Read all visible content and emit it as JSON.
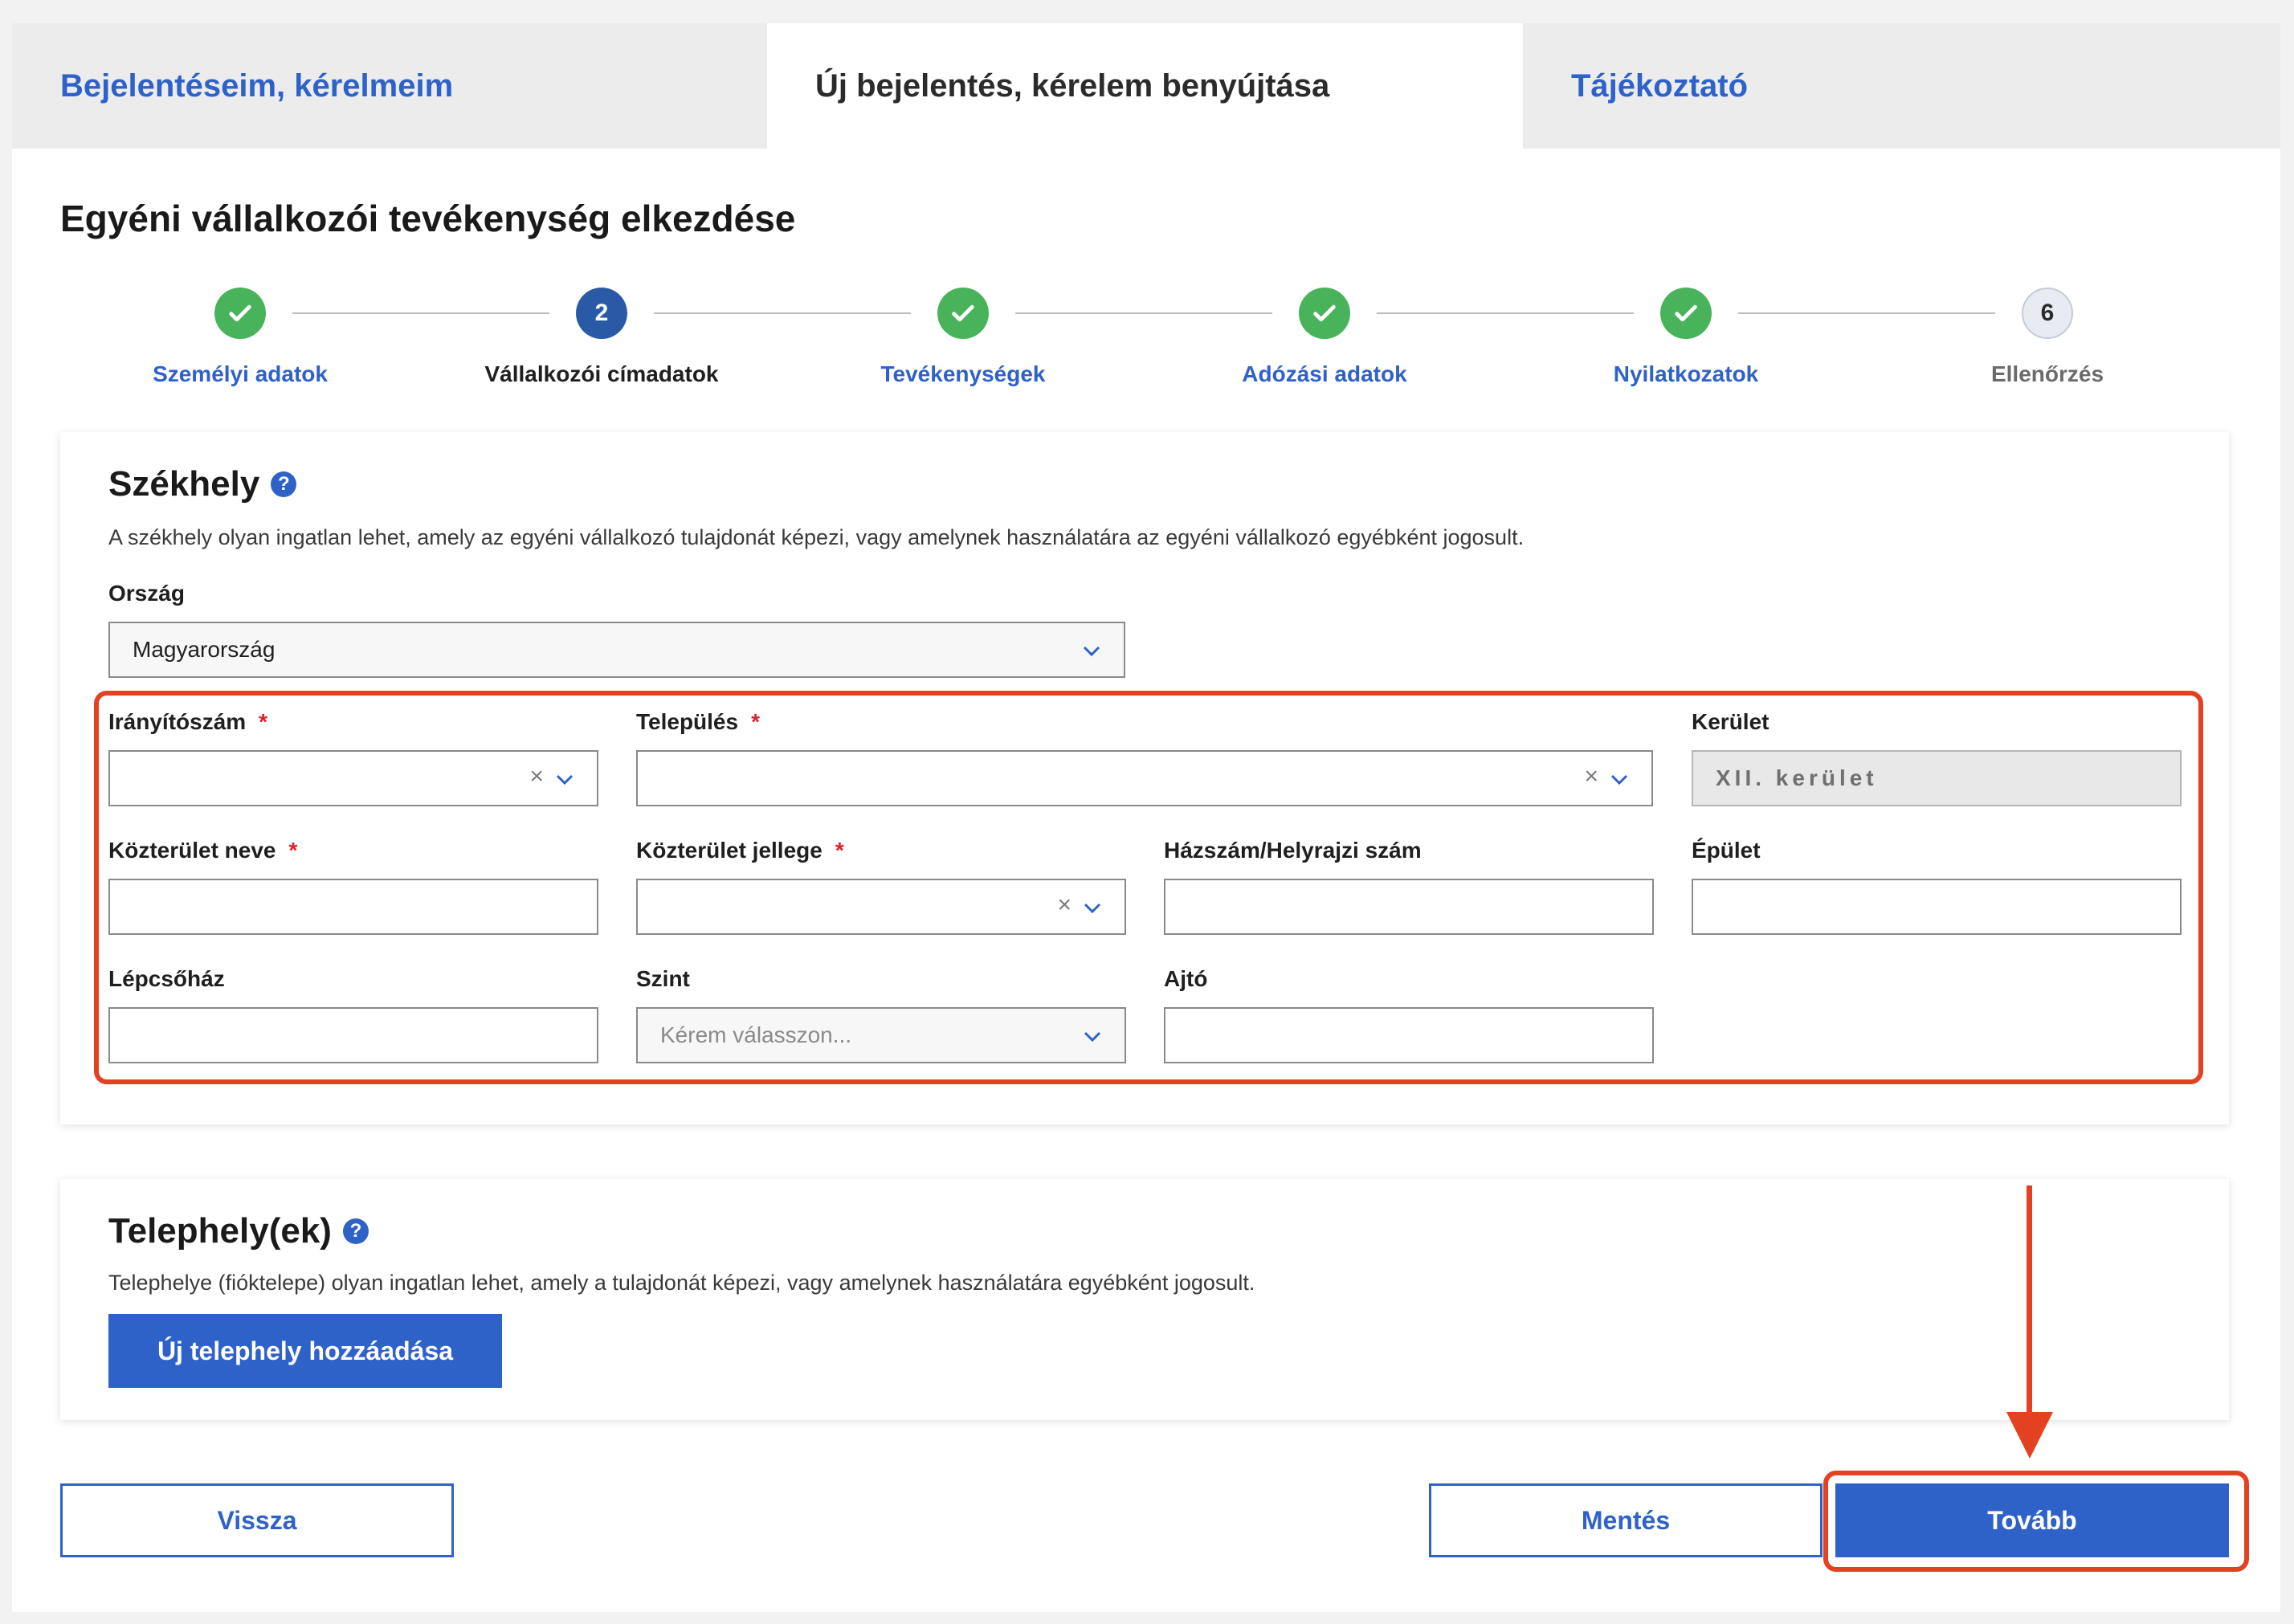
{
  "tabs": [
    {
      "label": "Bejelentéseim, kérelmeim"
    },
    {
      "label": "Új bejelentés, kérelem benyújtása"
    },
    {
      "label": "Tájékoztató"
    }
  ],
  "page_title": "Egyéni vállalkozói tevékenység elkezdése",
  "steps": [
    {
      "number": "1",
      "label": "Személyi adatok",
      "status": "done"
    },
    {
      "number": "2",
      "label": "Vállalkozói címadatok",
      "status": "active"
    },
    {
      "number": "3",
      "label": "Tevékenységek",
      "status": "done"
    },
    {
      "number": "4",
      "label": "Adózási adatok",
      "status": "done"
    },
    {
      "number": "5",
      "label": "Nyilatkozatok",
      "status": "done"
    },
    {
      "number": "6",
      "label": "Ellenőrzés",
      "status": "pending"
    }
  ],
  "szekhely": {
    "title": "Székhely",
    "help": "?",
    "description": "A székhely olyan ingatlan lehet, amely az egyéni vállalkozó tulajdonát képezi, vagy amelynek használatára az egyéni vállalkozó egyébként jogosult.",
    "orszag": {
      "label": "Ország",
      "value": "Magyarország"
    },
    "iranyitoszam": {
      "label": "Irányítószám",
      "required": "*",
      "value": ""
    },
    "telepules": {
      "label": "Település",
      "required": "*",
      "value": ""
    },
    "kerulet": {
      "label": "Kerület",
      "value": "XII. kerület"
    },
    "kozterulet_neve": {
      "label": "Közterület neve",
      "required": "*",
      "value": ""
    },
    "kozterulet_jellege": {
      "label": "Közterület jellege",
      "required": "*",
      "value": ""
    },
    "hazszam": {
      "label": "Házszám/Helyrajzi szám",
      "value": ""
    },
    "epulet": {
      "label": "Épület",
      "value": ""
    },
    "lepcsohaz": {
      "label": "Lépcsőház",
      "value": ""
    },
    "szint": {
      "label": "Szint",
      "placeholder": "Kérem válasszon..."
    },
    "ajto": {
      "label": "Ajtó",
      "value": ""
    }
  },
  "telephely": {
    "title": "Telephely(ek)",
    "help": "?",
    "description": "Telephelye (fióktelepe) olyan ingatlan lehet, amely a tulajdonát képezi, vagy amelynek használatára egyébként jogosult.",
    "add_button": "Új telephely hozzáadása"
  },
  "footer": {
    "back": "Vissza",
    "save": "Mentés",
    "next": "Tovább"
  },
  "icons": {
    "clear": "×",
    "check": "check-icon",
    "chevron": "chevron-down-icon"
  },
  "colors": {
    "accent": "#2f62c9",
    "success": "#49b35b",
    "highlight": "#e44123"
  }
}
